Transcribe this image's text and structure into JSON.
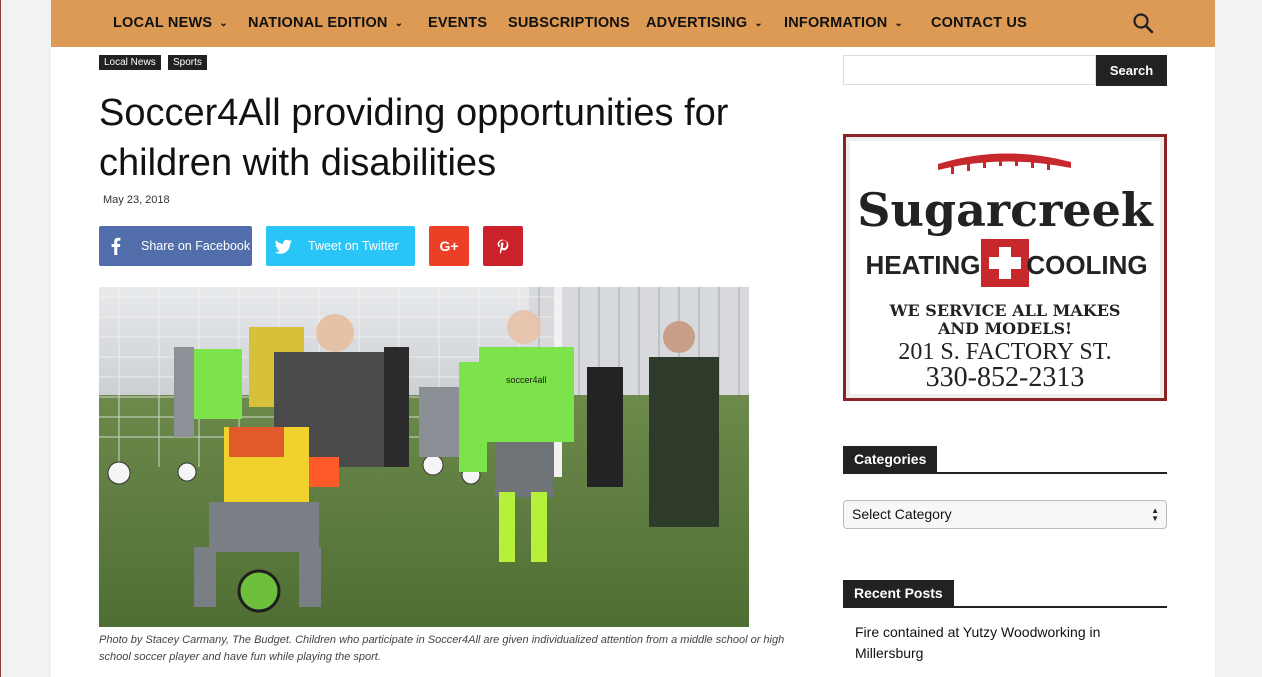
{
  "nav": {
    "items": [
      {
        "label": "LOCAL NEWS",
        "has_dropdown": true
      },
      {
        "label": "NATIONAL EDITION",
        "has_dropdown": true
      },
      {
        "label": "EVENTS",
        "has_dropdown": false
      },
      {
        "label": "SUBSCRIPTIONS",
        "has_dropdown": false
      },
      {
        "label": "ADVERTISING",
        "has_dropdown": true
      },
      {
        "label": "INFORMATION",
        "has_dropdown": true
      },
      {
        "label": "CONTACT US",
        "has_dropdown": false
      }
    ],
    "dropdown_glyph": "⌄",
    "search_icon": "magnifier-icon"
  },
  "article": {
    "tags": [
      "Local News",
      "Sports"
    ],
    "title": "Soccer4All providing opportunities for children with disabilities",
    "date": "May 23, 2018",
    "share": {
      "facebook": "Share on Facebook",
      "twitter": "Tweet on Twitter",
      "googleplus_glyph": "G+"
    },
    "caption": "Photo by Stacey Carmany, The Budget. Children who participate in Soccer4All are given individualized attention from a middle school or high school soccer player and have fun while playing the sport.",
    "jersey_text": "soccer4all"
  },
  "sidebar": {
    "search_placeholder": "",
    "search_button": "Search",
    "ad": {
      "brand": "Sugarcreek",
      "line1_left": "HEATING",
      "line1_right": "COOLING",
      "tagline1": "WE SERVICE ALL MAKES",
      "tagline2": "AND MODELS!",
      "address": "201 S. FACTORY ST.",
      "phone": "330-852-2313"
    },
    "categories_title": "Categories",
    "categories_select": "Select Category",
    "recent_title": "Recent Posts",
    "recent_posts": [
      "Fire contained at Yutzy Woodworking in Millersburg"
    ]
  },
  "colors": {
    "nav_bg": "#dd9a54",
    "facebook": "#516eab",
    "twitter": "#29c5f6",
    "googleplus": "#eb4026",
    "pinterest": "#ca212a",
    "dark": "#222222",
    "ad_frame": "#8b2323",
    "jersey": "#7de34a"
  }
}
